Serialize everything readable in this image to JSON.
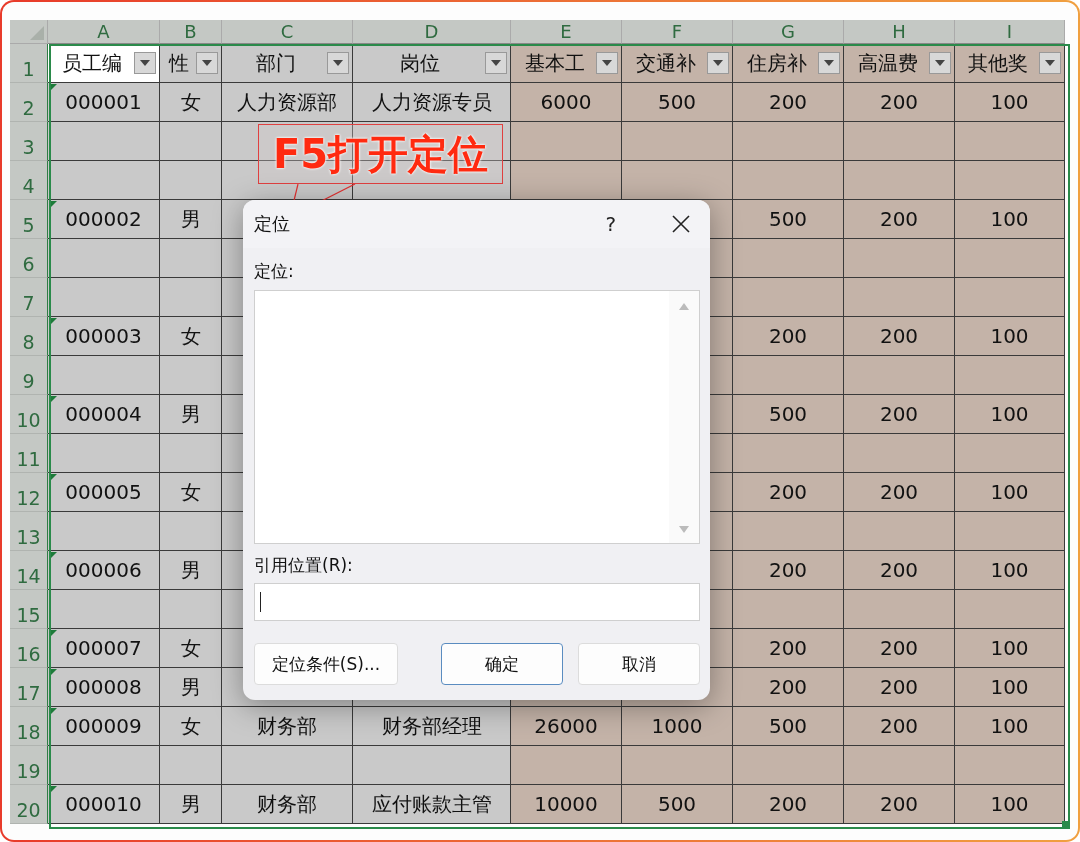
{
  "sheet": {
    "columns": [
      {
        "letter": "A",
        "shaded": false
      },
      {
        "letter": "B",
        "shaded": false
      },
      {
        "letter": "C",
        "shaded": false
      },
      {
        "letter": "D",
        "shaded": false
      },
      {
        "letter": "E",
        "shaded": true
      },
      {
        "letter": "F",
        "shaded": true
      },
      {
        "letter": "G",
        "shaded": true
      },
      {
        "letter": "H",
        "shaded": true
      },
      {
        "letter": "I",
        "shaded": true
      }
    ],
    "header_row": {
      "num": "1",
      "cells": [
        {
          "text": "员工编",
          "selected": true
        },
        {
          "text": "性",
          "selected": false
        },
        {
          "text": "部门",
          "selected": false
        },
        {
          "text": "岗位",
          "selected": false
        },
        {
          "text": "基本工",
          "selected": false
        },
        {
          "text": "交通补",
          "selected": false
        },
        {
          "text": "住房补",
          "selected": false
        },
        {
          "text": "高温费",
          "selected": false
        },
        {
          "text": "其他奖",
          "selected": false
        }
      ]
    },
    "rows": [
      {
        "num": "2",
        "flag": true,
        "cells": {
          "A": "000001",
          "B": "女",
          "C": "人力资源部",
          "D": "人力资源专员",
          "E": "6000",
          "F": "500",
          "G": "200",
          "H": "200",
          "I": "100"
        }
      },
      {
        "num": "3",
        "flag": false,
        "cells": {}
      },
      {
        "num": "4",
        "flag": false,
        "cells": {}
      },
      {
        "num": "5",
        "flag": true,
        "cells": {
          "A": "000002",
          "B": "男",
          "G": "500",
          "H": "200",
          "I": "100"
        }
      },
      {
        "num": "6",
        "flag": false,
        "cells": {}
      },
      {
        "num": "7",
        "flag": false,
        "cells": {}
      },
      {
        "num": "8",
        "flag": true,
        "cells": {
          "A": "000003",
          "B": "女",
          "G": "200",
          "H": "200",
          "I": "100"
        }
      },
      {
        "num": "9",
        "flag": false,
        "cells": {}
      },
      {
        "num": "10",
        "flag": true,
        "cells": {
          "A": "000004",
          "B": "男",
          "G": "500",
          "H": "200",
          "I": "100"
        }
      },
      {
        "num": "11",
        "flag": false,
        "cells": {}
      },
      {
        "num": "12",
        "flag": true,
        "cells": {
          "A": "000005",
          "B": "女",
          "G": "200",
          "H": "200",
          "I": "100"
        }
      },
      {
        "num": "13",
        "flag": false,
        "cells": {}
      },
      {
        "num": "14",
        "flag": true,
        "cells": {
          "A": "000006",
          "B": "男",
          "G": "200",
          "H": "200",
          "I": "100"
        }
      },
      {
        "num": "15",
        "flag": false,
        "cells": {}
      },
      {
        "num": "16",
        "flag": true,
        "cells": {
          "A": "000007",
          "B": "女",
          "G": "200",
          "H": "200",
          "I": "100"
        }
      },
      {
        "num": "17",
        "flag": true,
        "cells": {
          "A": "000008",
          "B": "男",
          "G": "200",
          "H": "200",
          "I": "100"
        }
      },
      {
        "num": "18",
        "flag": true,
        "cells": {
          "A": "000009",
          "B": "女",
          "C": "财务部",
          "D": "财务部经理",
          "E": "26000",
          "F": "1000",
          "G": "500",
          "H": "200",
          "I": "100"
        }
      },
      {
        "num": "19",
        "flag": false,
        "cells": {}
      },
      {
        "num": "20",
        "flag": true,
        "cells": {
          "A": "000010",
          "B": "男",
          "C": "财务部",
          "D": "应付账款主管",
          "E": "10000",
          "F": "500",
          "G": "200",
          "H": "200",
          "I": "100"
        }
      }
    ]
  },
  "callout": {
    "text": "F5打开定位"
  },
  "dialog": {
    "title": "定位",
    "help": "?",
    "list_label": "定位:",
    "reference_label": "引用位置(R):",
    "reference_field": {
      "focused": true
    },
    "buttons": [
      {
        "label": "定位条件(S)...",
        "default": false
      },
      {
        "label": "确定",
        "default": true
      },
      {
        "label": "取消",
        "default": false
      }
    ]
  }
}
